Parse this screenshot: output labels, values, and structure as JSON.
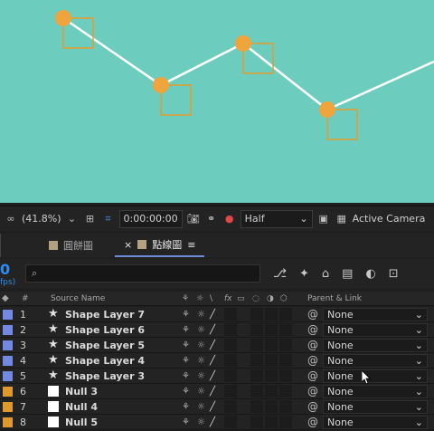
{
  "viewer": {
    "background": "#6ccdbf",
    "line_color": "#ffffff",
    "dot_color": "#f0a43c",
    "box_color": "#e59b2c"
  },
  "toolbar": {
    "zoom": "(41.8%)",
    "timecode": "0:00:00:00",
    "resolution": "Half",
    "camera": "Active Camera"
  },
  "tabs": [
    {
      "label": "圓餅圖"
    },
    {
      "label": "點線圖",
      "close": "×",
      "menu": "≡"
    }
  ],
  "timeline": {
    "time_fragment": "0",
    "fps_fragment": "fps)",
    "search_icon": "⌕"
  },
  "columns": {
    "num": "#",
    "source_name": "Source Name",
    "fx": "fx",
    "parent_link": "Parent & Link"
  },
  "layers": [
    {
      "num": "1",
      "name": "Shape Layer 7",
      "type": "shape",
      "label_color": "#7388e0",
      "parent": "None"
    },
    {
      "num": "2",
      "name": "Shape Layer 6",
      "type": "shape",
      "label_color": "#7388e0",
      "parent": "None"
    },
    {
      "num": "3",
      "name": "Shape Layer 5",
      "type": "shape",
      "label_color": "#7388e0",
      "parent": "None"
    },
    {
      "num": "4",
      "name": "Shape Layer 4",
      "type": "shape",
      "label_color": "#7388e0",
      "parent": "None"
    },
    {
      "num": "5",
      "name": "Shape Layer 3",
      "type": "shape",
      "label_color": "#7388e0",
      "parent": "None"
    },
    {
      "num": "6",
      "name": "Null 3",
      "type": "null",
      "label_color": "#e09a2a",
      "parent": "None"
    },
    {
      "num": "7",
      "name": "Null 4",
      "type": "null",
      "label_color": "#e09a2a",
      "parent": "None"
    },
    {
      "num": "8",
      "name": "Null 5",
      "type": "null",
      "label_color": "#e09a2a",
      "parent": "None"
    }
  ]
}
